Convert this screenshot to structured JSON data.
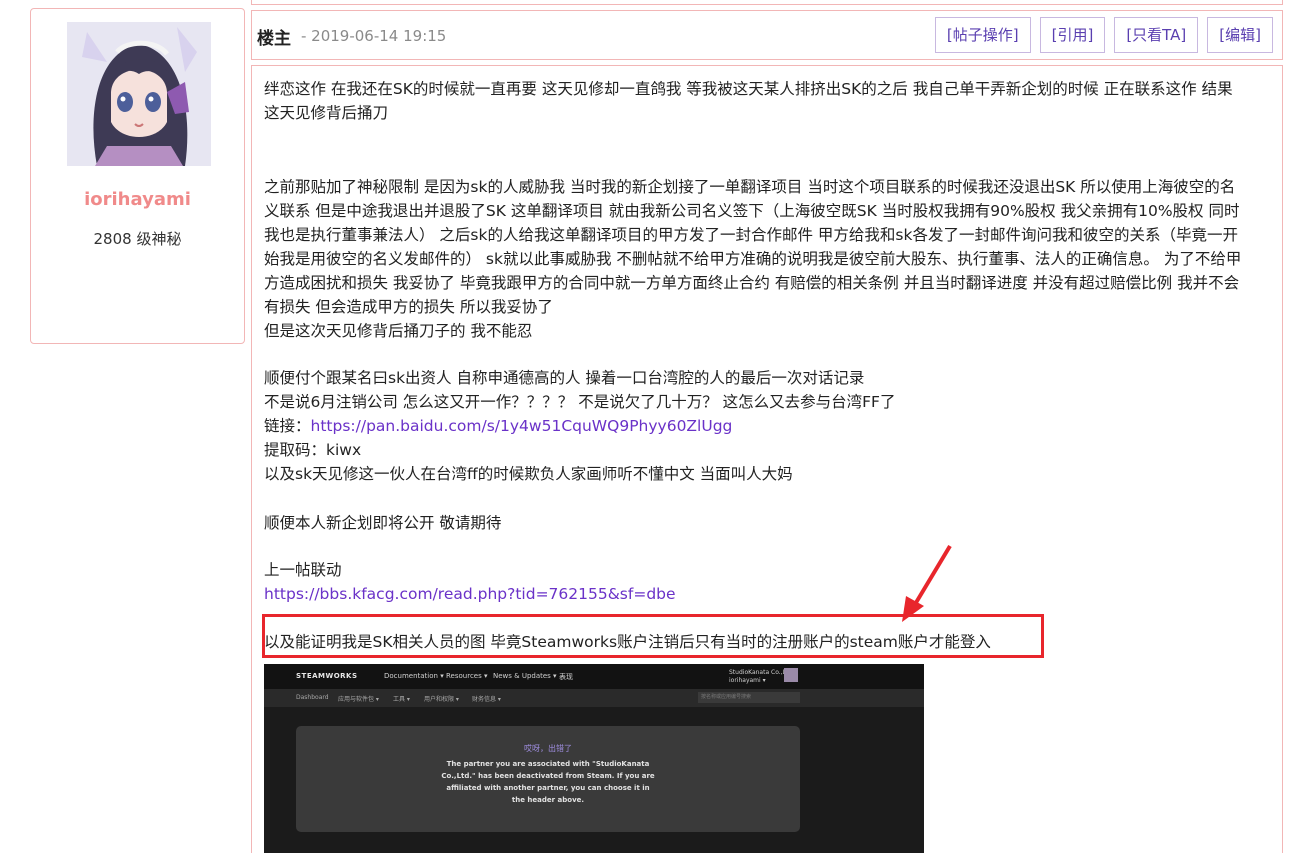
{
  "user": {
    "name": "iorihayami",
    "level": "2808 级神秘"
  },
  "post": {
    "floor_label": "楼主",
    "date": "- 2019-06-14 19:15",
    "actions": [
      "[帖子操作]",
      "[引用]",
      "[只看TA]",
      "[编辑]"
    ],
    "lines": [
      "绊恋这作 在我还在SK的时候就一直再要 这天见修却一直鸽我  等我被这天某人排挤出SK的之后 我自己单干弄新企划的时候 正在联系这作 结果",
      "这天见修背后捅刀",
      "之前那贴加了神秘限制 是因为sk的人威胁我 当时我的新企划接了一单翻译项目 当时这个项目联系的时候我还没退出SK 所以使用上海彼空的名",
      "义联系 但是中途我退出并退股了SK 这单翻译项目 就由我新公司名义签下（上海彼空既SK 当时股权我拥有90%股权 我父亲拥有10%股权 同时",
      "我也是执行董事兼法人）  之后sk的人给我这单翻译项目的甲方发了一封合作邮件 甲方给我和sk各发了一封邮件询问我和彼空的关系（毕竟一开",
      "始我是用彼空的名义发邮件的）  sk就以此事威胁我 不删帖就不给甲方准确的说明我是彼空前大股东、执行董事、法人的正确信息。 为了不给甲",
      "方造成困扰和损失 我妥协了 毕竟我跟甲方的合同中就一方单方面终止合约 有赔偿的相关条例 并且当时翻译进度 并没有超过赔偿比例 我并不会",
      "有损失 但会造成甲方的损失 所以我妥协了",
      "但是这次天见修背后捅刀子的 我不能忍",
      "顺便付个跟某名曰sk出资人 自称申通德高的人 操着一口台湾腔的人的最后一次对话记录",
      "不是说6月注销公司 怎么这又开一作？？？？  不是说欠了几十万？  这怎么又去参与台湾FF了"
    ],
    "link_label": "链接：",
    "link_url": "https://pan.baidu.com/s/1y4w51CquWQ9Phyy60ZlUgg",
    "code_line": "提取码：kiwx",
    "line_after_code": "以及sk天见修这一伙人在台湾ff的时候欺负人家画师听不懂中文 当面叫人大妈",
    "announce": "顺便本人新企划即将公开 敬请期待",
    "prev_label": "上一帖联动",
    "prev_url": "https://bbs.kfacg.com/read.php?tid=762155&sf=dbe",
    "highlight_text": "以及能证明我是SK相关人员的图  毕竟Steamworks账户注销后只有当时的注册账户的steam账户才能登入"
  },
  "steam_screenshot": {
    "logo": "STEAMWORKS",
    "menu": [
      "Documentation ▾",
      "Resources ▾",
      "News & Updates ▾",
      "表现"
    ],
    "account_name": "StudioKanata Co.,Ltd.",
    "account_user": "iorihayami ▾",
    "subnav": [
      "Dashboard",
      "应用与软件包 ▾",
      "工具 ▾",
      "用户和权限 ▾",
      "财务信息 ▾"
    ],
    "search_placeholder": "按名称或应用编号搜索",
    "error_title": "哎呀，出错了",
    "error_lines": [
      "The partner you are associated with \"StudioKanata",
      "Co.,Ltd.\" has been deactivated from Steam. If you are",
      "affiliated with another partner, you can choose it in",
      "the header above."
    ]
  },
  "colors": {
    "border": "#f2b6b6",
    "username": "#f08a8a",
    "link": "#6a32c8",
    "highlight": "#e8262c"
  }
}
